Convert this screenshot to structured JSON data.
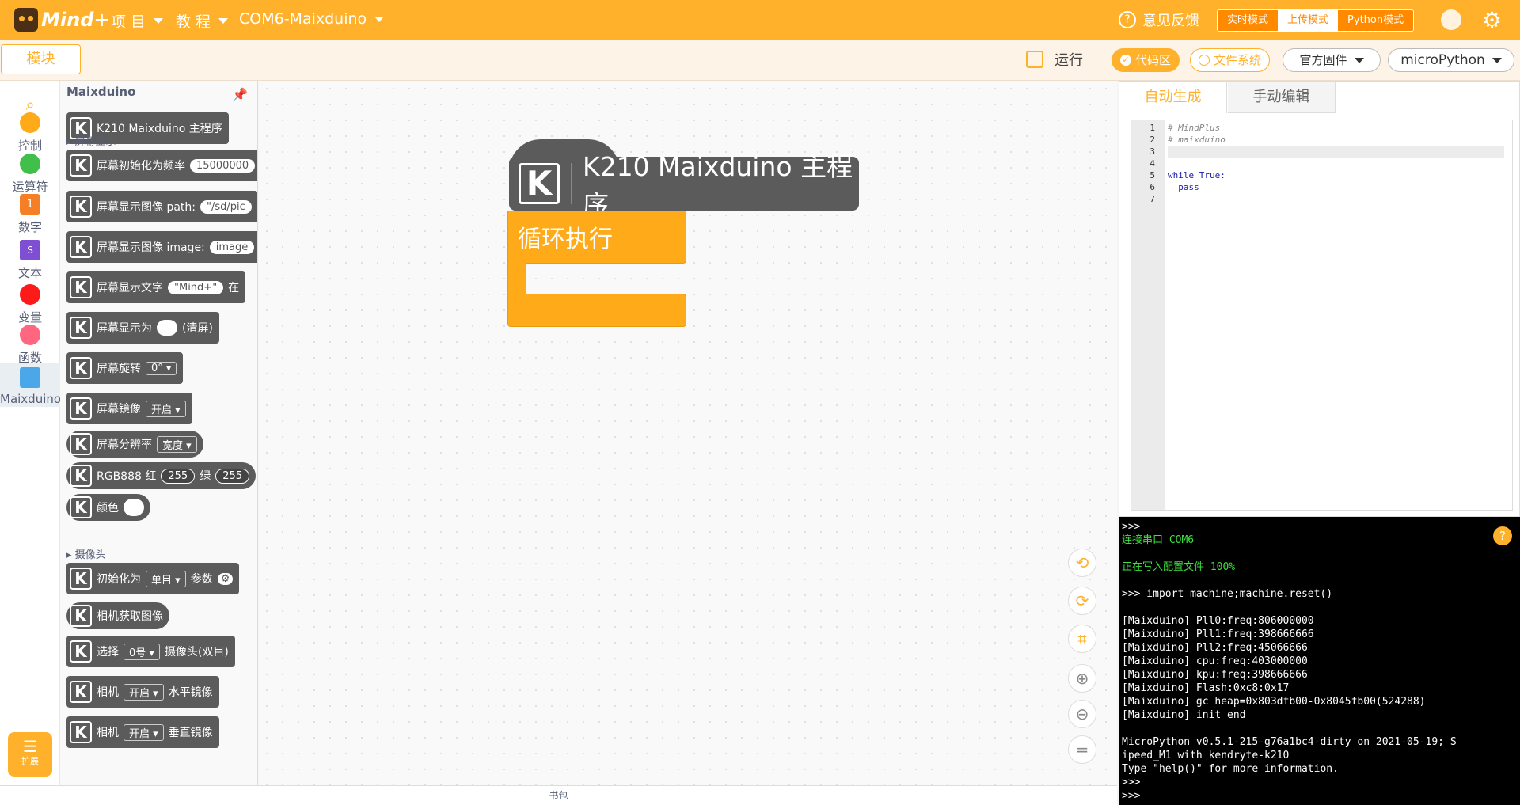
{
  "topbar": {
    "logo_text": "Mind+",
    "menu_project": "项 目",
    "menu_tutorial": "教 程",
    "menu_port": "COM6-Maixduino",
    "feedback": "意见反馈",
    "mode_realtime": "实时模式",
    "mode_upload": "上传模式",
    "mode_python": "Python模式"
  },
  "subbar": {
    "blocks_tab": "模块",
    "run": "运行",
    "code_area": "代码区",
    "file_system": "文件系统",
    "firmware": "官方固件",
    "language": "microPython"
  },
  "categories": [
    {
      "label": "控制",
      "color": "#ffab19"
    },
    {
      "label": "运算符",
      "color": "#40bf4a"
    },
    {
      "label": "数字",
      "color": "#f47f25"
    },
    {
      "label": "文本",
      "color": "#7e4fd3"
    },
    {
      "label": "变量",
      "color": "#ff1a1a"
    },
    {
      "label": "函数",
      "color": "#ff6680"
    },
    {
      "label": "Maixduino",
      "color": "#4ca7e8"
    }
  ],
  "extension": "扩展",
  "palette": {
    "title": "Maixduino",
    "sec_screen": "屏幕显示",
    "sec_camera": "摄像头",
    "b1": "K210 Maixduino 主程序",
    "b2": "屏幕初始化为频率",
    "b2_val": "15000000",
    "b3": "屏幕显示图像 path:",
    "b3_val": "\"/sd/pic",
    "b4": "屏幕显示图像 image:",
    "b4_val": "image",
    "b5": "屏幕显示文字",
    "b5_val": "\"Mind+\"",
    "b5_tail": "在",
    "b6": "屏幕显示为",
    "b6_tail": "(清屏)",
    "b7": "屏幕旋转",
    "b7_val": "0°",
    "b8": "屏幕镜像",
    "b8_val": "开启",
    "b9": "屏幕分辨率",
    "b9_val": "宽度",
    "b10": "RGB888 红",
    "b10_v1": "255",
    "b10_mid": "绿",
    "b10_v2": "255",
    "b11": "颜色",
    "b12": "初始化为",
    "b12_val": "单目",
    "b12_tail": "参数",
    "b13": "相机获取图像",
    "b14": "选择",
    "b14_val": "0号",
    "b14_tail": "摄像头(双目)",
    "b15": "相机",
    "b15_val": "开启",
    "b15_tail": "水平镜像",
    "b16": "相机",
    "b16_val": "开启",
    "b16_tail": "垂直镜像"
  },
  "canvas": {
    "main_block": "K210 Maixduino 主程序",
    "loop_block": "循环执行"
  },
  "backpack": "书包",
  "code_tabs": {
    "auto": "自动生成",
    "manual": "手动编辑"
  },
  "code_lines": [
    {
      "n": "1",
      "t": "# MindPlus"
    },
    {
      "n": "2",
      "t": "# maixduino"
    },
    {
      "n": "3",
      "t": ""
    },
    {
      "n": "4",
      "t": ""
    },
    {
      "n": "5",
      "t": "while True:"
    },
    {
      "n": "6",
      "t": "  pass"
    },
    {
      "n": "7",
      "t": ""
    }
  ],
  "console": [
    ">>>",
    "连接串口 COM6",
    "",
    "正在写入配置文件 100%",
    "",
    ">>> import machine;machine.reset()",
    "",
    "[Maixduino] Pll0:freq:806000000",
    "[Maixduino] Pll1:freq:398666666",
    "[Maixduino] Pll2:freq:45066666",
    "[Maixduino] cpu:freq:403000000",
    "[Maixduino] kpu:freq:398666666",
    "[Maixduino] Flash:0xc8:0x17",
    "[Maixduino] gc heap=0x803dfb00-0x8045fb00(524288)",
    "[Maixduino] init end",
    "",
    "MicroPython v0.5.1-215-g76a1bc4-dirty on 2021-05-19; S",
    "ipeed_M1 with kendryte-k210",
    "Type \"help()\" for more information.",
    ">>>",
    ">>>"
  ]
}
